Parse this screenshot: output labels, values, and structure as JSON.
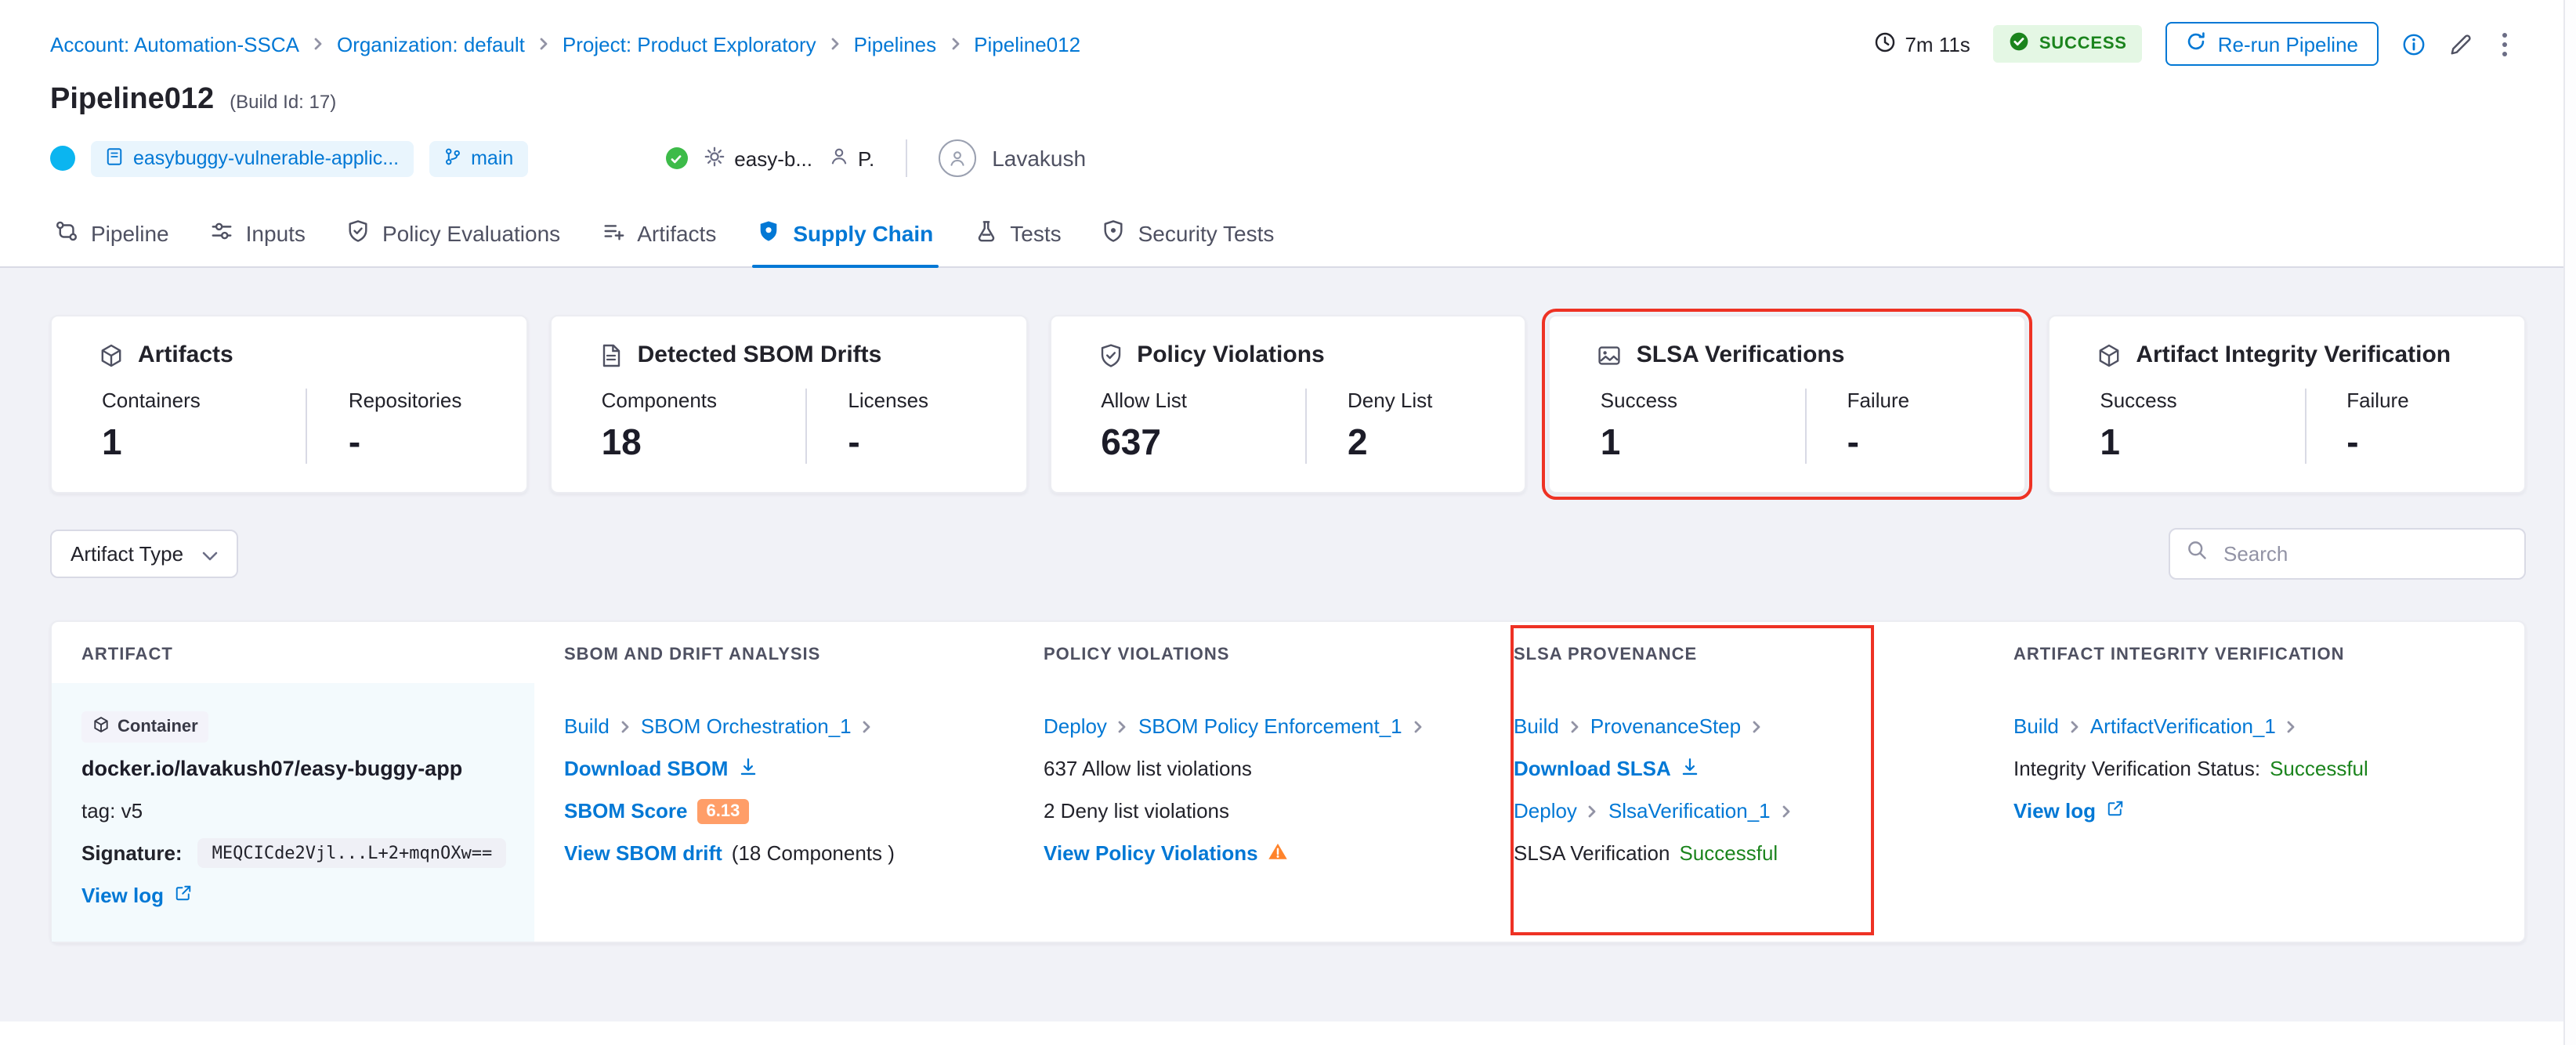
{
  "colors": {
    "accent": "#0278d5",
    "highlight_red": "#ee3224",
    "success_green": "#1b841d",
    "warning_orange": "#ff832b",
    "page_background": "#f1f2f7"
  },
  "breadcrumb": {
    "items": [
      "Account: Automation-SSCA",
      "Organization: default",
      "Project: Product Exploratory",
      "Pipelines",
      "Pipeline012"
    ]
  },
  "header": {
    "duration": "7m 11s",
    "status_badge": "SUCCESS",
    "rerun_button": "Re-run Pipeline",
    "title": "Pipeline012",
    "build_id": "(Build Id: 17)"
  },
  "meta": {
    "repo": "easybuggy-vulnerable-applic...",
    "branch": "main",
    "service": "easy-b...",
    "p_label": "P.",
    "user": "Lavakush"
  },
  "tabs": [
    {
      "label": "Pipeline",
      "icon": "pipeline-icon"
    },
    {
      "label": "Inputs",
      "icon": "inputs-icon"
    },
    {
      "label": "Policy Evaluations",
      "icon": "shield-check-icon"
    },
    {
      "label": "Artifacts",
      "icon": "list-plus-icon"
    },
    {
      "label": "Supply Chain",
      "icon": "shield-icon",
      "active": true
    },
    {
      "label": "Tests",
      "icon": "flask-icon"
    },
    {
      "label": "Security Tests",
      "icon": "shield-dot-icon"
    }
  ],
  "cards": [
    {
      "title": "Artifacts",
      "icon": "cube-icon",
      "col1_label": "Containers",
      "col1_value": "1",
      "col2_label": "Repositories",
      "col2_value": "-"
    },
    {
      "title": "Detected SBOM Drifts",
      "icon": "document-icon",
      "col1_label": "Components",
      "col1_value": "18",
      "col2_label": "Licenses",
      "col2_value": "-"
    },
    {
      "title": "Policy Violations",
      "icon": "shield-check-icon",
      "col1_label": "Allow List",
      "col1_value": "637",
      "col2_label": "Deny List",
      "col2_value": "2"
    },
    {
      "title": "SLSA Verifications",
      "icon": "badge-icon",
      "col1_label": "Success",
      "col1_value": "1",
      "col2_label": "Failure",
      "col2_value": "-",
      "highlighted": true
    },
    {
      "title": "Artifact Integrity Verification",
      "icon": "cube-icon",
      "col1_label": "Success",
      "col1_value": "1",
      "col2_label": "Failure",
      "col2_value": "-"
    }
  ],
  "filters": {
    "artifact_type": "Artifact Type",
    "search_placeholder": "Search"
  },
  "table": {
    "headers": [
      "ARTIFACT",
      "SBOM AND DRIFT ANALYSIS",
      "POLICY VIOLATIONS",
      "SLSA PROVENANCE",
      "ARTIFACT INTEGRITY VERIFICATION"
    ],
    "row": {
      "artifact": {
        "type": "Container",
        "name": "docker.io/lavakush07/easy-buggy-app",
        "tag": "tag: v5",
        "signature_label": "Signature:",
        "signature_value": "MEQCICde2Vjl...L+2+mqnOXw==",
        "view_log": "View log"
      },
      "sbom": {
        "stage": "Build",
        "step": "SBOM Orchestration_1",
        "download": "Download SBOM",
        "score_link": "SBOM Score",
        "score_value": "6.13",
        "drift_link": "View SBOM drift",
        "drift_count": "(18 Components )"
      },
      "policy": {
        "stage": "Deploy",
        "step": "SBOM Policy Enforcement_1",
        "allow_text": "637 Allow list violations",
        "deny_text": "2 Deny list violations",
        "view_link": "View Policy Violations"
      },
      "slsa": {
        "stage1": "Build",
        "step1": "ProvenanceStep",
        "download": "Download SLSA",
        "stage2": "Deploy",
        "step2": "SlsaVerification_1",
        "status_label": "SLSA Verification",
        "status_value": "Successful"
      },
      "integrity": {
        "stage": "Build",
        "step": "ArtifactVerification_1",
        "status_label": "Integrity Verification Status:",
        "status_value": "Successful",
        "view_log": "View log"
      }
    }
  }
}
